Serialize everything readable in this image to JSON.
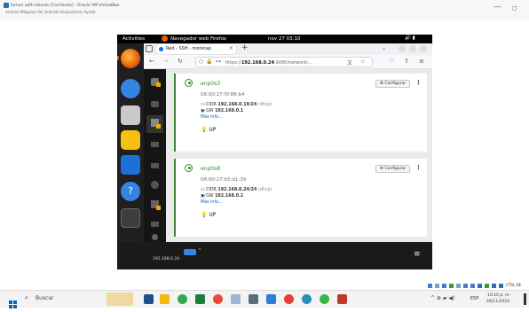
{
  "vbox": {
    "title": "Server with Ubuntu [Corriendo] - Oracle VM VirtualBox",
    "menu": "Archivo  Máquina  Ver  Entrada  Dispositivos  Ayuda",
    "min": "—",
    "restore": "◻"
  },
  "gnome": {
    "activities": "Activities",
    "app": "Navegador web Firefox",
    "clock": "nov 27  03:10",
    "sys": "🔊 ▮"
  },
  "firefox": {
    "tab_title": "Red - SSH - monicap",
    "url": "https://192.168.0.24:9090/network",
    "url_prefix": "https://",
    "url_host": "192.168.0.24",
    "url_rest": ":9090/network/..."
  },
  "interfaces": [
    {
      "name": "enp0s3",
      "mac": "08:00:27:5f:88:b4",
      "cidr_label": "CIDR",
      "cidr": "192.168.0.19/24",
      "cidr_note": "(dhcp)",
      "gw_label": "GW",
      "gw": "192.168.0.1",
      "more": "Más info...",
      "state": "UP",
      "btn": "⚙ Configurar"
    },
    {
      "name": "enp0s8",
      "mac": "08:00:27:b5:d1:39",
      "cidr_label": "CIDR",
      "cidr": "192.168.0.24/24",
      "cidr_note": "(dhcp)",
      "gw_label": "GW",
      "gw": "192.168.0.1",
      "more": "Más info...",
      "state": "UP",
      "btn": "⚙ Configurar"
    }
  ],
  "vm_bottom": {
    "ip": "192.168.0.24"
  },
  "taskbar": {
    "search": "Buscar",
    "lang": "ESP",
    "time": "10:10 p. m.",
    "date": "26/11/2023",
    "ctrl": "CTRL DE"
  },
  "colors": {
    "ubuntu_orange": "#e95420",
    "green": "#3e8635",
    "link": "#0066cc"
  }
}
